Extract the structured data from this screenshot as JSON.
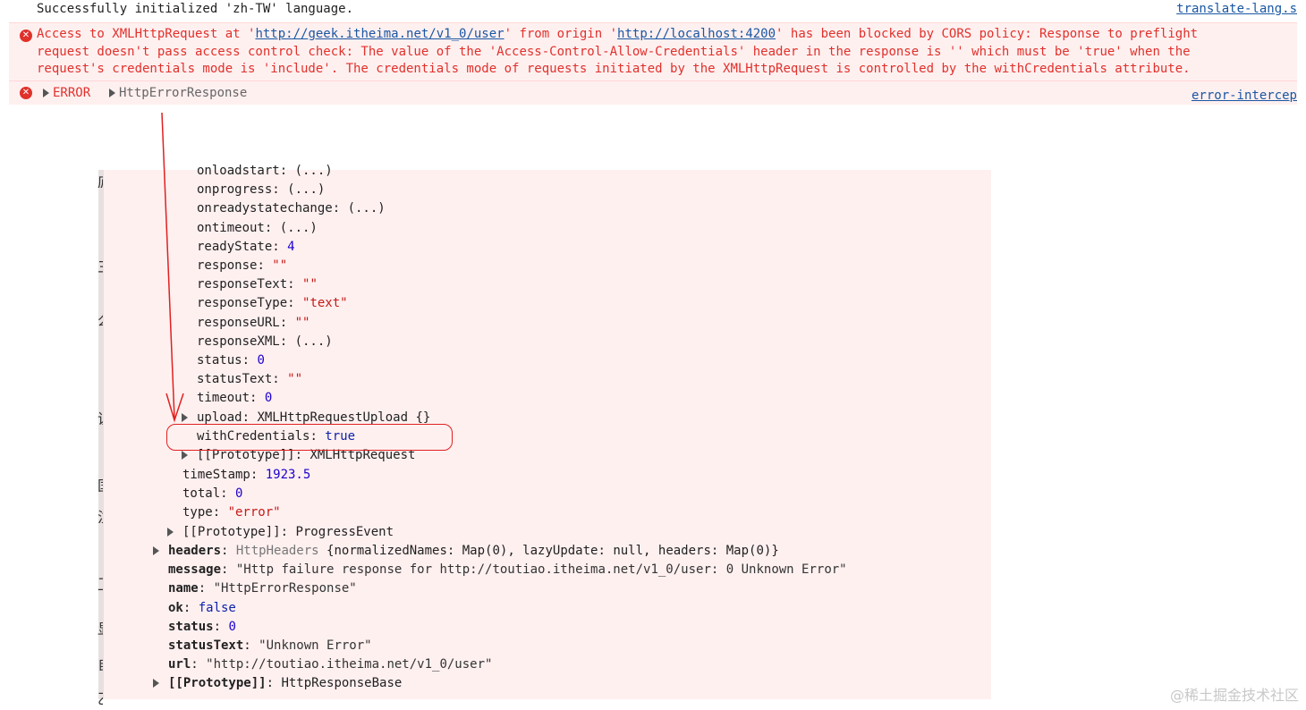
{
  "top_log": {
    "text": "Successfully initialized 'zh-TW' language.",
    "source": "translate-lang.s"
  },
  "cors_error": {
    "part1": "Access to XMLHttpRequest at '",
    "url1": "http://geek.itheima.net/v1_0/user",
    "part2": "' from origin '",
    "url2": "http://localhost:4200",
    "part3": "' has been blocked by CORS policy: Response to preflight",
    "line2": "request doesn't pass access control check: The value of the 'Access-Control-Allow-Credentials' header in the response is '' which must be 'true' when the",
    "line3": "request's credentials mode is 'include'. The credentials mode of requests initiated by the XMLHttpRequest is controlled by the withCredentials attribute."
  },
  "error_line": {
    "label": "ERROR",
    "object": "HttpErrorResponse",
    "source": "error-intercep"
  },
  "xhr_props": [
    {
      "key": "onloadstart",
      "value": "(...)",
      "type": "obj"
    },
    {
      "key": "onprogress",
      "value": "(...)",
      "type": "obj"
    },
    {
      "key": "onreadystatechange",
      "value": "(...)",
      "type": "obj"
    },
    {
      "key": "ontimeout",
      "value": "(...)",
      "type": "obj"
    },
    {
      "key": "readyState",
      "value": "4",
      "type": "num"
    },
    {
      "key": "response",
      "value": "\"\"",
      "type": "str"
    },
    {
      "key": "responseText",
      "value": "\"\"",
      "type": "str"
    },
    {
      "key": "responseType",
      "value": "\"text\"",
      "type": "str"
    },
    {
      "key": "responseURL",
      "value": "\"\"",
      "type": "str"
    },
    {
      "key": "responseXML",
      "value": "(...)",
      "type": "obj"
    },
    {
      "key": "status",
      "value": "0",
      "type": "num"
    },
    {
      "key": "statusText",
      "value": "\"\"",
      "type": "str"
    },
    {
      "key": "timeout",
      "value": "0",
      "type": "num"
    },
    {
      "key": "upload",
      "value": "XMLHttpRequestUpload {}",
      "type": "obj",
      "expandable": true
    },
    {
      "key": "withCredentials",
      "value": "true",
      "type": "kw"
    },
    {
      "key": "[[Prototype]]",
      "value": "XMLHttpRequest",
      "type": "obj",
      "expandable": true
    }
  ],
  "event_props": [
    {
      "key": "timeStamp",
      "value": "1923.5",
      "type": "num"
    },
    {
      "key": "total",
      "value": "0",
      "type": "num"
    },
    {
      "key": "type",
      "value": "\"error\"",
      "type": "str"
    },
    {
      "key": "[[Prototype]]",
      "value": "ProgressEvent",
      "type": "obj",
      "expandable": true
    }
  ],
  "response_props": [
    {
      "key": "headers",
      "value_prefix": "HttpHeaders ",
      "value": "{normalizedNames: Map(0), lazyUpdate: null, headers: Map(0)}",
      "type": "obj",
      "expandable": true
    },
    {
      "key": "message",
      "value": "\"Http failure response for http://toutiao.itheima.net/v1_0/user: 0 Unknown Error\"",
      "type": "str2"
    },
    {
      "key": "name",
      "value": "\"HttpErrorResponse\"",
      "type": "str2"
    },
    {
      "key": "ok",
      "value": "false",
      "type": "kw"
    },
    {
      "key": "status",
      "value": "0",
      "type": "num"
    },
    {
      "key": "statusText",
      "value": "\"Unknown Error\"",
      "type": "str2"
    },
    {
      "key": "url",
      "value": "\"http://toutiao.itheima.net/v1_0/user\"",
      "type": "str2"
    },
    {
      "key": "[[Prototype]]",
      "value": "HttpResponseBase",
      "type": "obj",
      "expandable": true
    }
  ],
  "side_glyphs": [
    "庐",
    "三",
    "么",
    "说",
    "国",
    "注",
    "卫",
    "显",
    "自",
    "乙"
  ],
  "watermark": "@稀土掘金技术社区",
  "colors": {
    "error_red": "#e0312b",
    "error_bg": "#fff0f0",
    "link_blue": "#1a57a3",
    "annotation_red": "#e02020"
  }
}
